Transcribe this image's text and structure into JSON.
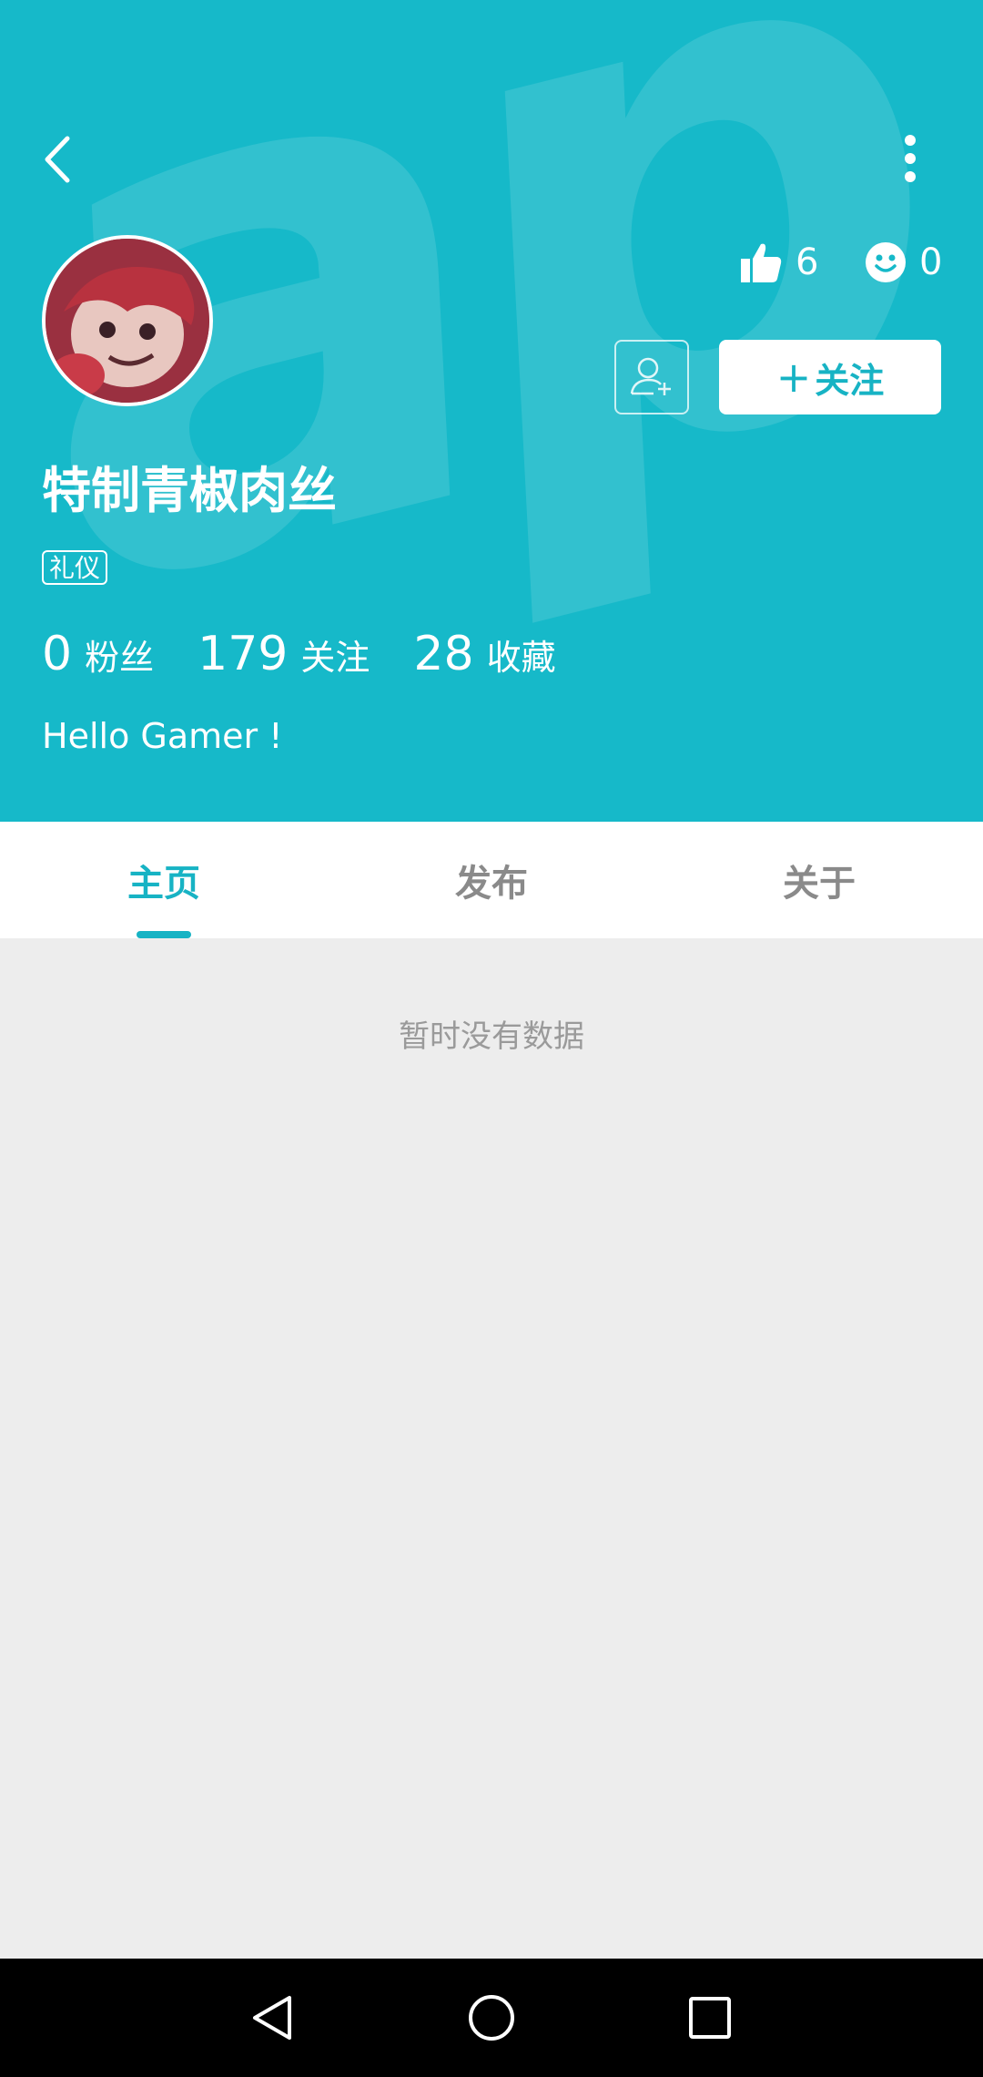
{
  "header": {
    "background_color": "#16b9c9",
    "watermark_text": "apTap",
    "likes_count": "6",
    "emoji_count": "0",
    "follow_label": "关注",
    "follow_plus": "+"
  },
  "profile": {
    "username": "特制青椒肉丝",
    "tag": "礼仪",
    "bio": "Hello Gamer !",
    "stats": [
      {
        "value": "0",
        "label": "粉丝"
      },
      {
        "value": "179",
        "label": "关注"
      },
      {
        "value": "28",
        "label": "收藏"
      }
    ]
  },
  "tabs": [
    {
      "label": "主页",
      "active": true
    },
    {
      "label": "发布",
      "active": false
    },
    {
      "label": "关于",
      "active": false
    }
  ],
  "content": {
    "empty_text": "暂时没有数据"
  },
  "icons": [
    "back-icon",
    "more-vert-icon",
    "thumbs-up-icon",
    "smiley-icon",
    "add-friend-icon",
    "nav-back-icon",
    "nav-home-icon",
    "nav-recents-icon"
  ],
  "accent_color": "#17b3c4"
}
